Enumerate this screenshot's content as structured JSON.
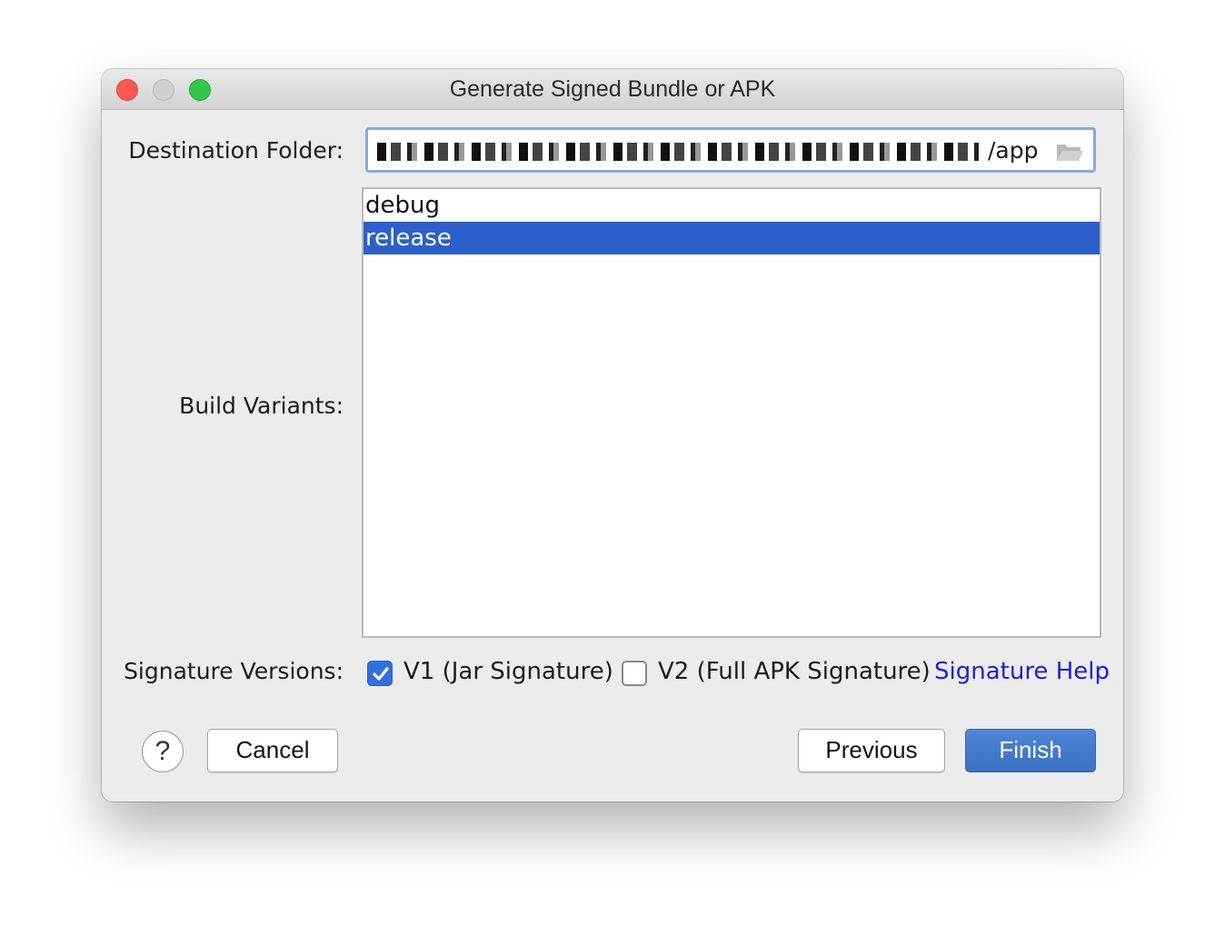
{
  "window": {
    "title": "Generate Signed Bundle or APK"
  },
  "destination": {
    "label": "Destination Folder:",
    "value_visible_suffix": "/app"
  },
  "build_variants": {
    "label": "Build Variants:",
    "items": [
      {
        "label": "debug",
        "selected": false
      },
      {
        "label": "release",
        "selected": true
      }
    ]
  },
  "signature": {
    "label": "Signature Versions:",
    "v1": {
      "label": "V1 (Jar Signature)",
      "checked": true
    },
    "v2": {
      "label": "V2 (Full APK Signature)",
      "checked": false
    },
    "help_link": "Signature Help"
  },
  "buttons": {
    "help": "?",
    "cancel": "Cancel",
    "previous": "Previous",
    "finish": "Finish"
  },
  "colors": {
    "selection": "#2d5fcb",
    "checkbox_checked": "#2f6fe0",
    "link": "#1d1fd6",
    "primary_button": "#3a6fc2"
  }
}
